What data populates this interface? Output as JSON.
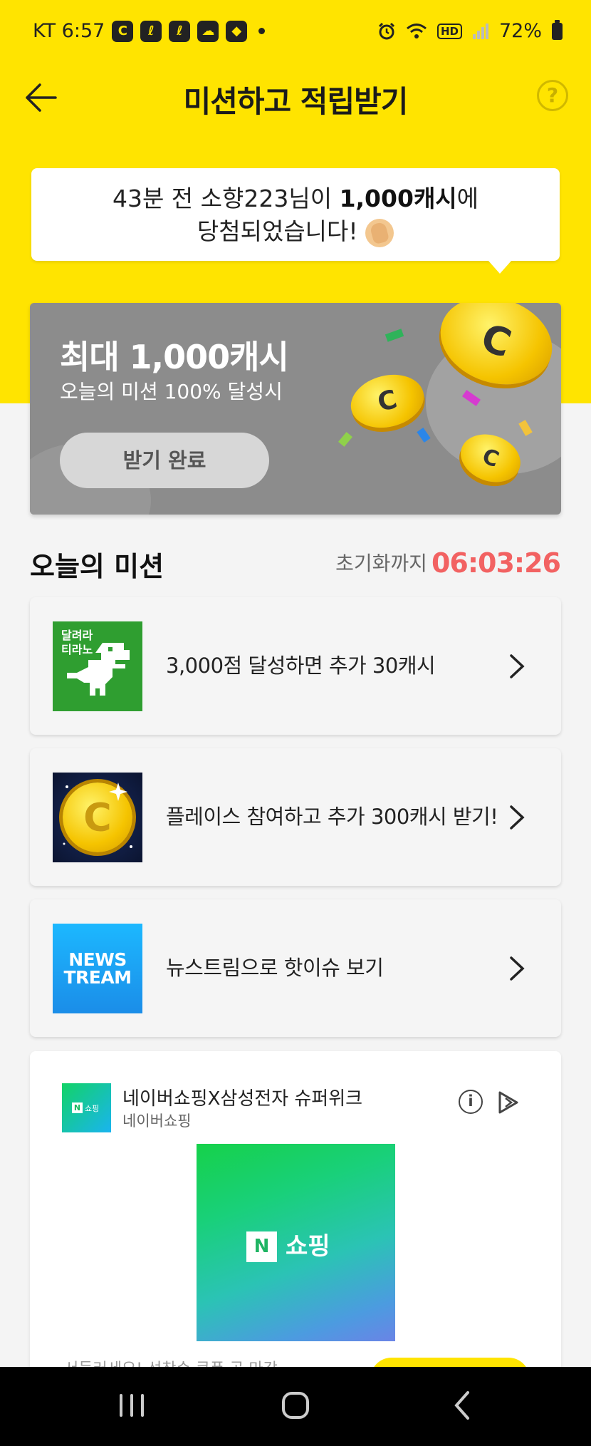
{
  "status_bar": {
    "carrier_time": "KT 6:57",
    "app_icons": [
      "C",
      "ℓ",
      "ℓ",
      "☁",
      "◆"
    ],
    "hd_label": "HD",
    "battery": "72%"
  },
  "header": {
    "title": "미션하고 적립받기",
    "help": "?"
  },
  "notice": {
    "line1_prefix": "43분 전 소향223님이 ",
    "line1_highlight": "1,000캐시",
    "line1_suffix": "에",
    "line2": "당첨되었습니다!"
  },
  "reward": {
    "title": "최대 1,000캐시",
    "subtitle": "오늘의 미션 100% 달성시",
    "button": "받기 완료"
  },
  "missions_section": {
    "title": "오늘의 미션",
    "reset_label": "초기화까지",
    "reset_time": "06:03:26"
  },
  "missions": [
    {
      "icon": "dino-game-icon",
      "thumb_text": "달려라\n티라노",
      "text": "3,000점 달성하면 추가 30캐시"
    },
    {
      "icon": "gold-coin-icon",
      "thumb_text": "",
      "text": "플레이스 참여하고 추가 300캐시 받기!"
    },
    {
      "icon": "newstream-icon",
      "thumb_text": "NEWS\nTREAM",
      "text": "뉴스트림으로 핫이슈 보기"
    }
  ],
  "ad": {
    "logo_n": "N",
    "logo_text": "쇼핑",
    "title": "네이버쇼핑X삼성전자 슈퍼위크",
    "advertiser": "네이버쇼핑",
    "info": "i",
    "image_n": "N",
    "image_label": "쇼핑",
    "bottom_text": "서둘러세요! 선착순 쿠폰 곧 마감"
  },
  "colors": {
    "brand_yellow": "#ffe400",
    "reset_time_red": "#f26262",
    "banner_gray": "#8c8c8c"
  }
}
